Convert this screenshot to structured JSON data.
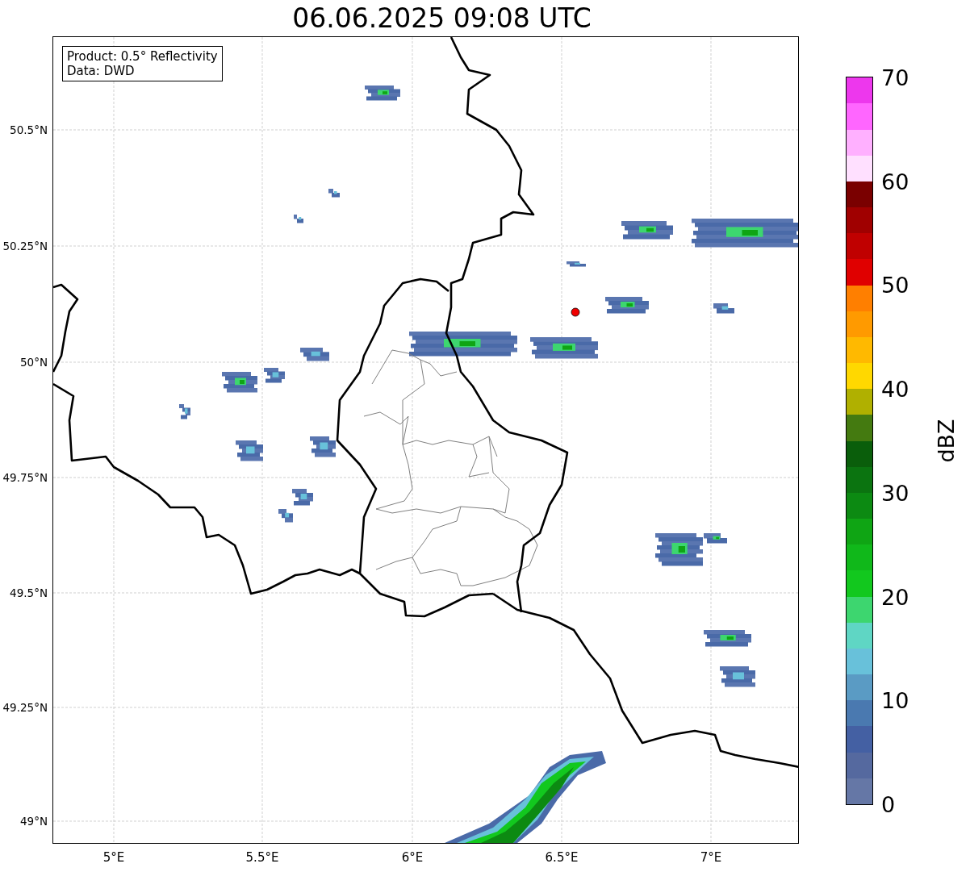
{
  "title": "06.06.2025 09:08 UTC",
  "legend": [
    "Product: 0.5° Reflectivity",
    "Data: DWD"
  ],
  "y_ticks": [
    "50.5°N",
    "50.25°N",
    "50°N",
    "49.75°N",
    "49.5°N",
    "49.25°N",
    "49°N"
  ],
  "x_ticks": [
    "5°E",
    "5.5°E",
    "6°E",
    "6.5°E",
    "7°E"
  ],
  "colorbar": {
    "label": "dBZ",
    "ticks": [
      "70",
      "60",
      "50",
      "40",
      "30",
      "20",
      "10",
      "0"
    ],
    "segments": [
      {
        "color": "#6577a6"
      },
      {
        "color": "#55699f"
      },
      {
        "color": "#4460a3"
      },
      {
        "color": "#4a79b0"
      },
      {
        "color": "#5a9bc4"
      },
      {
        "color": "#68c1da"
      },
      {
        "color": "#5fd6c4"
      },
      {
        "color": "#3dd66f"
      },
      {
        "color": "#12c81e"
      },
      {
        "color": "#10b81a"
      },
      {
        "color": "#0fa514"
      },
      {
        "color": "#0c8a12"
      },
      {
        "color": "#0b7410"
      },
      {
        "color": "#0a5e0b"
      },
      {
        "color": "#447a10"
      },
      {
        "color": "#b0b000"
      },
      {
        "color": "#ffd800"
      },
      {
        "color": "#ffb900"
      },
      {
        "color": "#ff9a00"
      },
      {
        "color": "#ff7f00"
      },
      {
        "color": "#e00000"
      },
      {
        "color": "#c00000"
      },
      {
        "color": "#a00000"
      },
      {
        "color": "#7a0000"
      },
      {
        "color": "#ffe0ff"
      },
      {
        "color": "#ffb0ff"
      },
      {
        "color": "#ff66ff"
      },
      {
        "color": "#ed37ed"
      }
    ]
  }
}
